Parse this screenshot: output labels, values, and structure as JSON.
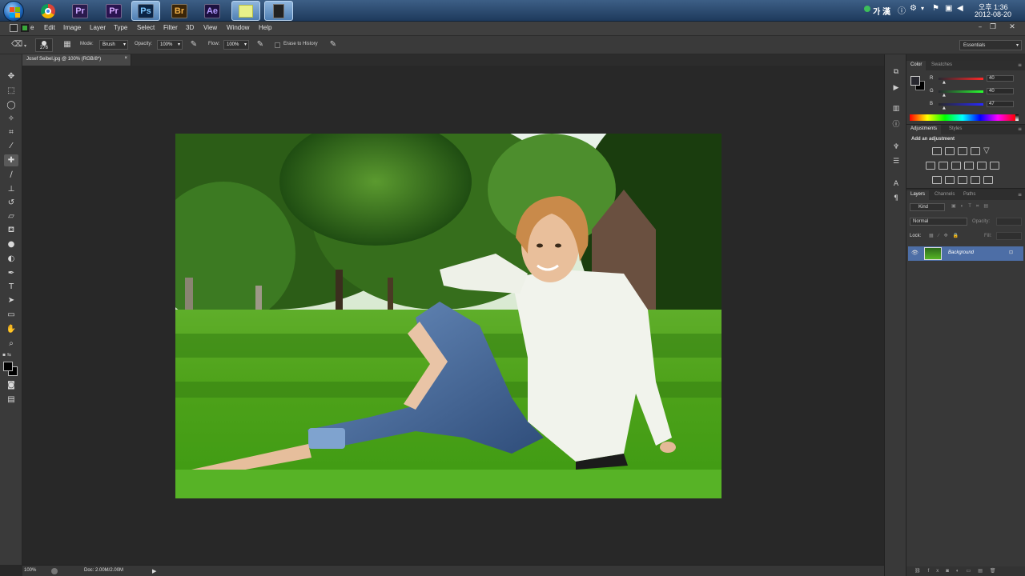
{
  "taskbar": {
    "apps": [
      {
        "label": "",
        "name": "chrome-icon"
      },
      {
        "label": "Pr",
        "name": "premiere-icon"
      },
      {
        "label": "Pr",
        "name": "premiere-icon-2"
      },
      {
        "label": "Ps",
        "name": "photoshop-icon"
      },
      {
        "label": "Br",
        "name": "bridge-icon"
      },
      {
        "label": "Ae",
        "name": "after-effects-icon"
      }
    ],
    "ime": "가 漢",
    "time": "오후 1:36",
    "date": "2012-08-20"
  },
  "menubar": {
    "items": [
      "Edit",
      "Image",
      "Layer",
      "Type",
      "Select",
      "Filter",
      "3D",
      "View",
      "Window",
      "Help"
    ],
    "file_truncated": "e"
  },
  "options": {
    "brush_size": "276",
    "mode_label": "Mode:",
    "mode_value": "Brush",
    "opacity_label": "Opacity:",
    "opacity_value": "100%",
    "flow_label": "Flow:",
    "flow_value": "100%",
    "erase_history_label": "Erase to History",
    "workspace": "Essentials"
  },
  "document": {
    "tab_title": "Josef Seibel.jpg @ 100% (RGB/8*)"
  },
  "status": {
    "zoom": "100%",
    "doc_size": "Doc: 2.00M/2.00M"
  },
  "color_panel": {
    "tabs": [
      "Color",
      "Swatches"
    ],
    "r_label": "R",
    "r_value": "40",
    "g_label": "G",
    "g_value": "40",
    "b_label": "B",
    "b_value": "47",
    "fg_color": "#28282f"
  },
  "adjustments_panel": {
    "tabs": [
      "Adjustments",
      "Styles"
    ],
    "heading": "Add an adjustment"
  },
  "layers_panel": {
    "tabs": [
      "Layers",
      "Channels",
      "Paths"
    ],
    "kind_label": "Kind",
    "blend_mode": "Normal",
    "opacity_label": "Opacity:",
    "lock_label": "Lock:",
    "fill_label": "Fill:",
    "layers": [
      {
        "name": "Background"
      }
    ]
  },
  "colors": {
    "accent": "#4d6ea6"
  }
}
